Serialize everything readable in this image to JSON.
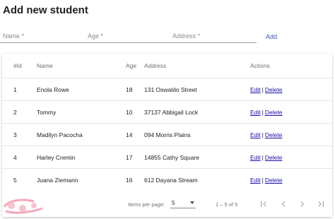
{
  "page": {
    "title": "Add new student"
  },
  "form": {
    "name_placeholder": "Name *",
    "age_placeholder": "Age *",
    "address_placeholder": "Address *",
    "add_label": "Add"
  },
  "table": {
    "headers": {
      "id": "#Id",
      "name": "Name",
      "age": "Age",
      "address": "Address",
      "actions": "Actions"
    },
    "rows": [
      {
        "id": "1",
        "name": "Enola Rowe",
        "age": "18",
        "address": "131 Oswaldo Street",
        "edit": "Edit",
        "sep": "|",
        "delete": "Delete"
      },
      {
        "id": "2",
        "name": "Tommy",
        "age": "10",
        "address": "37137 Abbigail Lock",
        "edit": "Edit",
        "sep": "|",
        "delete": "Delete"
      },
      {
        "id": "3",
        "name": "Madilyn Pacocha",
        "age": "14",
        "address": "094 Morris Plains",
        "edit": "Edit",
        "sep": "|",
        "delete": "Delete"
      },
      {
        "id": "4",
        "name": "Harley Cremin",
        "age": "17",
        "address": "14855 Cathy Square",
        "edit": "Edit",
        "sep": "|",
        "delete": "Delete"
      },
      {
        "id": "5",
        "name": "Juana Ziemann",
        "age": "16",
        "address": "612 Dayana Stream",
        "edit": "Edit",
        "sep": "|",
        "delete": "Delete"
      }
    ]
  },
  "paginator": {
    "items_per_page_label": "Items per page:",
    "page_size": "5",
    "range_label": "1 – 5 of 5"
  },
  "icons": {
    "first_page": "first-page-icon",
    "prev_page": "chevron-left-icon",
    "next_page": "chevron-right-icon",
    "last_page": "last-page-icon"
  },
  "colors": {
    "link": "#1a0dab",
    "accent": "#3f51b5"
  }
}
